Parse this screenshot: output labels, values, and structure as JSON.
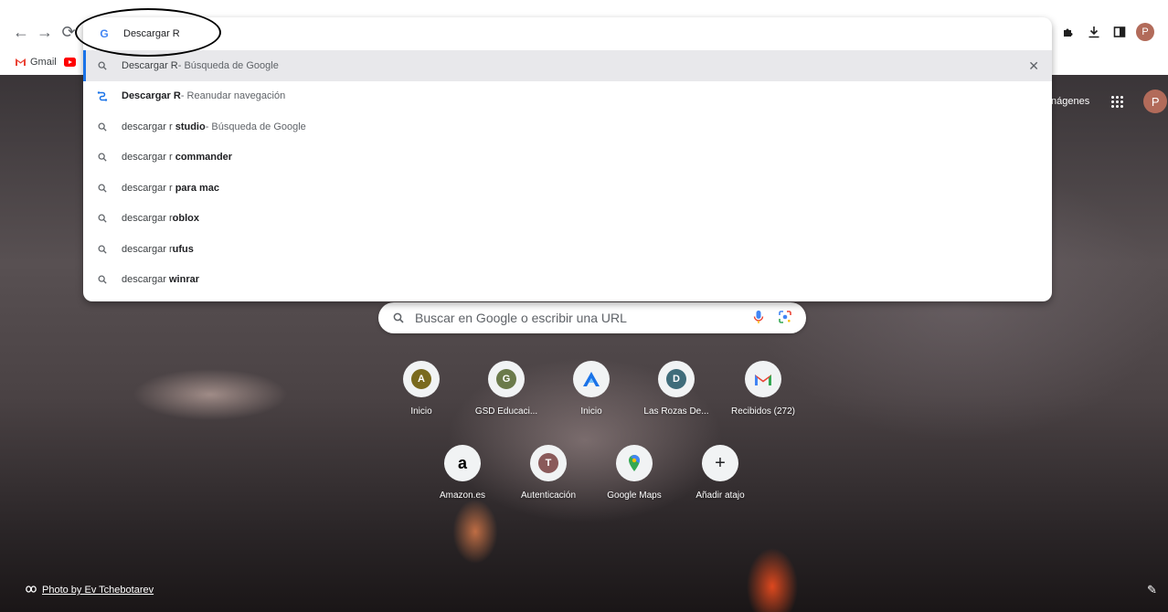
{
  "toolbar": {
    "back_icon": "back-arrow-icon",
    "forward_icon": "forward-arrow-icon",
    "reload_icon": "reload-icon",
    "right_icons": [
      "puzzle-icon",
      "download-icon",
      "side-panel-icon"
    ],
    "avatar_letter": "P",
    "avatar_color": "#b26b5a"
  },
  "bookmarks": {
    "items": [
      {
        "label": "Gmail",
        "icon": "gmail-icon"
      },
      {
        "label": "",
        "icon": "youtube-icon"
      }
    ]
  },
  "omnibox": {
    "query": "Descargar R",
    "suggestions": [
      {
        "prefix": "Descargar R",
        "bold": "",
        "suffix": " - Búsqueda de Google",
        "icon": "search-icon",
        "selected": true
      },
      {
        "prefix": "",
        "bold": "Descargar R",
        "suffix": " - Reanudar navegación",
        "icon": "journey-icon",
        "selected": false
      },
      {
        "prefix": "descargar r ",
        "bold": "studio",
        "suffix": " - Búsqueda de Google",
        "icon": "search-icon",
        "selected": false
      },
      {
        "prefix": "descargar r ",
        "bold": "commander",
        "suffix": "",
        "icon": "search-icon",
        "selected": false
      },
      {
        "prefix": "descargar r ",
        "bold": "para mac",
        "suffix": "",
        "icon": "search-icon",
        "selected": false
      },
      {
        "prefix": "descargar r",
        "bold": "oblox",
        "suffix": "",
        "icon": "search-icon",
        "selected": false
      },
      {
        "prefix": "descargar r",
        "bold": "ufus",
        "suffix": "",
        "icon": "search-icon",
        "selected": false
      },
      {
        "prefix": "descargar ",
        "bold": "winrar",
        "suffix": "",
        "icon": "search-icon",
        "selected": false
      }
    ]
  },
  "ntp": {
    "images_link": "nágenes",
    "avatar_letter": "P",
    "search_placeholder": "Buscar en Google o escribir una URL",
    "shortcuts_row1": [
      {
        "label": "Inicio",
        "letter": "A",
        "color": "#7a6a1e"
      },
      {
        "label": "GSD Educaci...",
        "letter": "G",
        "color": "#6b7a4a"
      },
      {
        "label": "Inicio",
        "letter": "",
        "color": "#1a73e8"
      },
      {
        "label": "Las Rozas De...",
        "letter": "D",
        "color": "#3f6c7a"
      },
      {
        "label": "Recibidos (272)",
        "letter": "M",
        "color": "#ea4335"
      }
    ],
    "shortcuts_row2": [
      {
        "label": "Amazon.es",
        "letter": "a",
        "color": "#000000"
      },
      {
        "label": "Autenticación",
        "letter": "T",
        "color": "#8a5a5a"
      },
      {
        "label": "Google Maps",
        "letter": "",
        "color": "#34a853"
      },
      {
        "label": "Añadir atajo",
        "letter": "+",
        "color": "#202124"
      }
    ],
    "photo_credit": "Photo by Ev Tchebotarev"
  }
}
